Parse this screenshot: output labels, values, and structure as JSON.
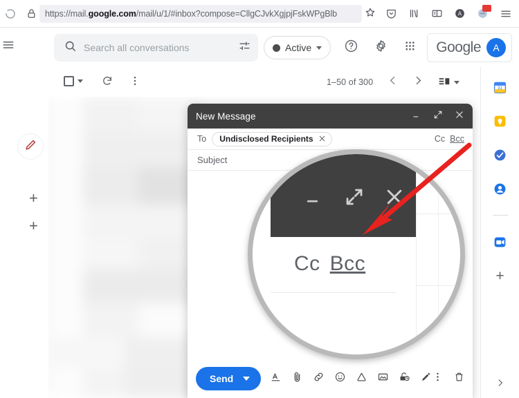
{
  "browser": {
    "url_prefix": "https://mail.",
    "url_bold": "google.com",
    "url_suffix": "/mail/u/1/#inbox?compose=CllgCJvkXgjpjFskWPgBlb",
    "back_icon": "back-arrow-icon",
    "lock_icon": "padlock-icon",
    "bookmark_icon": "star-icon",
    "toolbar_icons": [
      "pocket-save-icon",
      "library-icon",
      "reader-view-icon",
      "account-icon",
      "extension-icon",
      "app-menu-icon"
    ]
  },
  "gmail_header": {
    "menu_icon": "hamburger-menu-icon",
    "search": {
      "placeholder": "Search all conversations",
      "search_icon": "search-icon",
      "filter_icon": "tune-filter-icon"
    },
    "status": {
      "label": "Active",
      "dropdown_icon": "chevron-down-icon",
      "dot_color": "#4d4d4d"
    },
    "help_icon": "help-circle-icon",
    "settings_icon": "gear-icon",
    "apps_icon": "apps-grid-icon",
    "brand": "Google",
    "avatar_initial": "A",
    "avatar_color": "#1a73e8"
  },
  "left_rail": {
    "compose_icon": "pencil-compose-icon",
    "compose_icon_color": "#b0413e",
    "add_icon_1": "plus-icon",
    "add_icon_2": "plus-icon"
  },
  "list_toolbar": {
    "select_all_checkbox": "checkbox-icon",
    "select_dropdown_icon": "chevron-down-icon",
    "refresh_icon": "refresh-icon",
    "more_icon": "more-vertical-icon",
    "pagination": "1–50 of 300",
    "prev_icon": "chevron-left-icon",
    "next_icon": "chevron-right-icon",
    "layout_icon": "split-pane-icon",
    "layout_dropdown_icon": "chevron-down-icon"
  },
  "compose": {
    "title": "New Message",
    "minimize_icon": "minimize-icon",
    "expand_icon": "expand-icon",
    "close_icon": "close-icon",
    "to_label": "To",
    "recipient_chip": "Undisclosed Recipients",
    "chip_remove_icon": "close-icon",
    "cc_label": "Cc",
    "bcc_label": "Bcc",
    "subject_placeholder": "Subject",
    "send_label": "Send",
    "send_dropdown_icon": "chevron-down-icon",
    "send_color": "#1a73e8",
    "toolbar_icons": [
      "formatting-options-icon",
      "attach-file-icon",
      "insert-link-icon",
      "insert-emoji-icon",
      "insert-drive-file-icon",
      "insert-photo-icon",
      "confidential-mode-icon",
      "insert-signature-icon"
    ],
    "more_options_icon": "more-vertical-icon",
    "discard_icon": "trash-icon"
  },
  "right_rail": {
    "icons": [
      {
        "name": "google-calendar-icon",
        "color": "#4285f4"
      },
      {
        "name": "google-keep-icon",
        "color": "#fbbc04"
      },
      {
        "name": "google-tasks-icon",
        "color": "#3b6fd4"
      },
      {
        "name": "google-contacts-icon",
        "color": "#1a73e8"
      },
      {
        "name": "google-meet-icon",
        "color": "#1a73e8"
      }
    ],
    "add_icon": "plus-icon",
    "expand_icon": "chevron-right-icon"
  },
  "magnifier": {
    "minimize_icon": "minimize-icon",
    "expand_icon": "expand-icon",
    "close_icon": "close-icon",
    "cc_label": "Cc",
    "bcc_label": "Bcc"
  },
  "annotation": {
    "arrow_color": "#e8221f",
    "arrow_from": "678,212",
    "arrow_to": "528,338",
    "arrow_target": "bcc-link"
  }
}
